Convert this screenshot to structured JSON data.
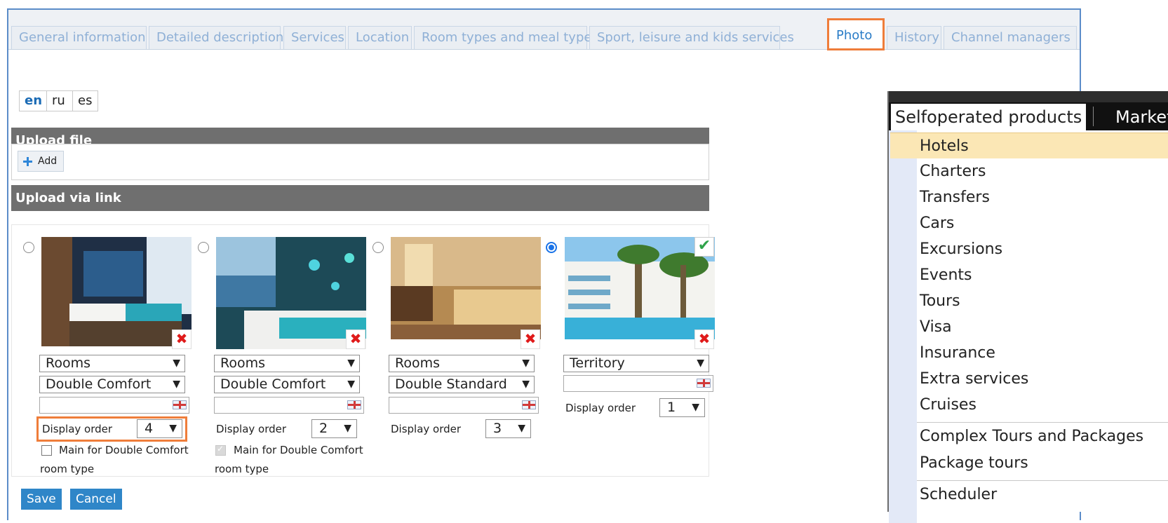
{
  "tabs": [
    {
      "label": "General information"
    },
    {
      "label": "Detailed description"
    },
    {
      "label": "Services"
    },
    {
      "label": "Location"
    },
    {
      "label": "Room types and meal types"
    },
    {
      "label": "Sport, leisure and kids services"
    },
    {
      "label": "Photo",
      "active": true
    },
    {
      "label": "History"
    },
    {
      "label": "Channel managers"
    }
  ],
  "languages": [
    "en",
    "ru",
    "es"
  ],
  "active_language": "en",
  "upload_file": {
    "title": "Upload file",
    "add_label": "Add"
  },
  "upload_link": {
    "title": "Upload via link"
  },
  "photos": [
    {
      "selected": false,
      "category": "Rooms",
      "room_type": "Double Comfort",
      "display_order_label": "Display order",
      "display_order": "4",
      "main_label": "Main for Double Comfort",
      "main_label2": "room type",
      "main_checked": false,
      "main_disabled": false
    },
    {
      "selected": false,
      "category": "Rooms",
      "room_type": "Double Comfort",
      "display_order_label": "Display order",
      "display_order": "2",
      "main_label": "Main for Double Comfort",
      "main_label2": "room type",
      "main_checked": true,
      "main_disabled": true
    },
    {
      "selected": false,
      "category": "Rooms",
      "room_type": "Double Standard",
      "display_order_label": "Display order",
      "display_order": "3"
    },
    {
      "selected": true,
      "category": "Territory",
      "display_order_label": "Display order",
      "display_order": "1"
    }
  ],
  "buttons": {
    "save": "Save",
    "cancel": "Cancel"
  },
  "menu": {
    "header_active": "Selfoperated products",
    "header_next": "Market",
    "items": [
      "Hotels",
      "Charters",
      "Transfers",
      "Cars",
      "Excursions",
      "Events",
      "Tours",
      "Visa",
      "Insurance",
      "Extra services",
      "Cruises",
      "Complex Tours and Packages",
      "Package tours",
      "Scheduler"
    ],
    "highlighted": "Hotels"
  },
  "colors": {
    "accent": "#ef7d3a",
    "link": "#2a7cc7",
    "header_bar": "#6f6f6f",
    "highlight": "#fbe7b5"
  }
}
